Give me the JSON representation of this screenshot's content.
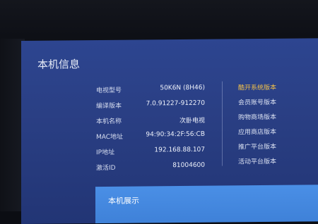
{
  "page_title": "本机信息",
  "info_rows": [
    {
      "label": "电视型号",
      "value": "50K6N (8H46)"
    },
    {
      "label": "编译版本",
      "value": "7.0.91227-912270"
    },
    {
      "label": "本机名称",
      "value": "次卧电视"
    },
    {
      "label": "MAC地址",
      "value": "94:90:34:2F:56:CB"
    },
    {
      "label": "IP地址",
      "value": "192.168.88.107"
    },
    {
      "label": "激活ID",
      "value": "81004600"
    }
  ],
  "side_menu": [
    {
      "label": "酷开系统版本",
      "active": true
    },
    {
      "label": "会员账号版本",
      "active": false
    },
    {
      "label": "购物商场版本",
      "active": false
    },
    {
      "label": "应用商店版本",
      "active": false
    },
    {
      "label": "推广平台版本",
      "active": false
    },
    {
      "label": "活动平台版本",
      "active": false
    }
  ],
  "bottom_card": {
    "label": "本机展示"
  },
  "colors": {
    "accent": "#f0c04a",
    "screen_bg": "#2a3f84",
    "card_bg": "#4a8fe6"
  }
}
